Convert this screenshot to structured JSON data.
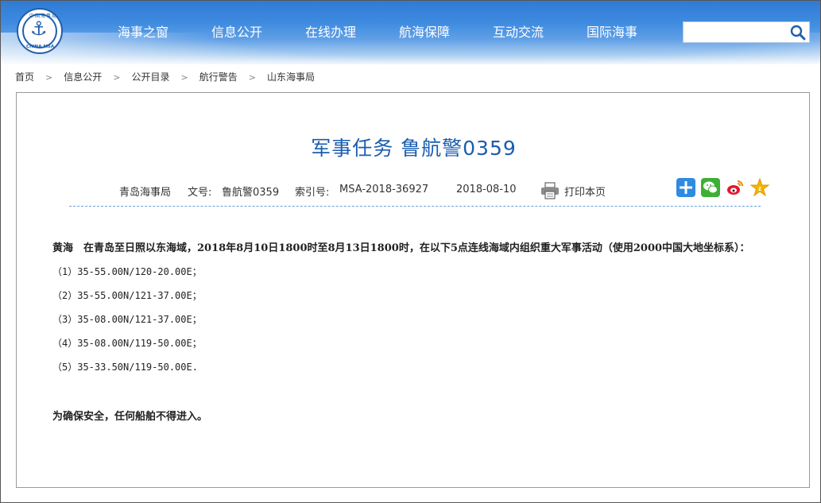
{
  "header": {
    "logo": {
      "icon": "anchor-icon",
      "top_text": "中国海事局",
      "bottom_text": "CHINA MSA"
    },
    "nav": [
      "海事之窗",
      "信息公开",
      "在线办理",
      "航海保障",
      "互动交流",
      "国际海事"
    ],
    "search": {
      "placeholder": "",
      "icon": "search-icon"
    }
  },
  "breadcrumb": [
    "首页",
    "信息公开",
    "公开目录",
    "航行警告",
    "山东海事局"
  ],
  "article": {
    "title": "军事任务 鲁航警0359",
    "meta": {
      "source": "青岛海事局",
      "doc_label": "文号:",
      "doc_no": "鲁航警0359",
      "index_label": "索引号:",
      "index_no": "MSA-2018-36927",
      "date": "2018-08-10",
      "print_label": "打印本页"
    },
    "share_icons": [
      "add-share-icon",
      "wechat-icon",
      "weibo-icon",
      "qzone-icon"
    ],
    "lead": "黄海　在青岛至日照以东海域，2018年8月10日1800时至8月13日1800时，在以下5点连线海域内组织重大军事活动（使用2000中国大地坐标系）：",
    "points": [
      "（1）35-55.00N/120-20.00E；",
      "（2）35-55.00N/121-37.00E；",
      "（3）35-08.00N/121-37.00E；",
      "（4）35-08.00N/119-50.00E；",
      "（5）35-33.50N/119-50.00E."
    ],
    "footer": "为确保安全，任何船舶不得进入。"
  },
  "colors": {
    "nav_bg": "#3a86dc",
    "title": "#1a5daf",
    "dashed_line": "#6aa0d8"
  }
}
